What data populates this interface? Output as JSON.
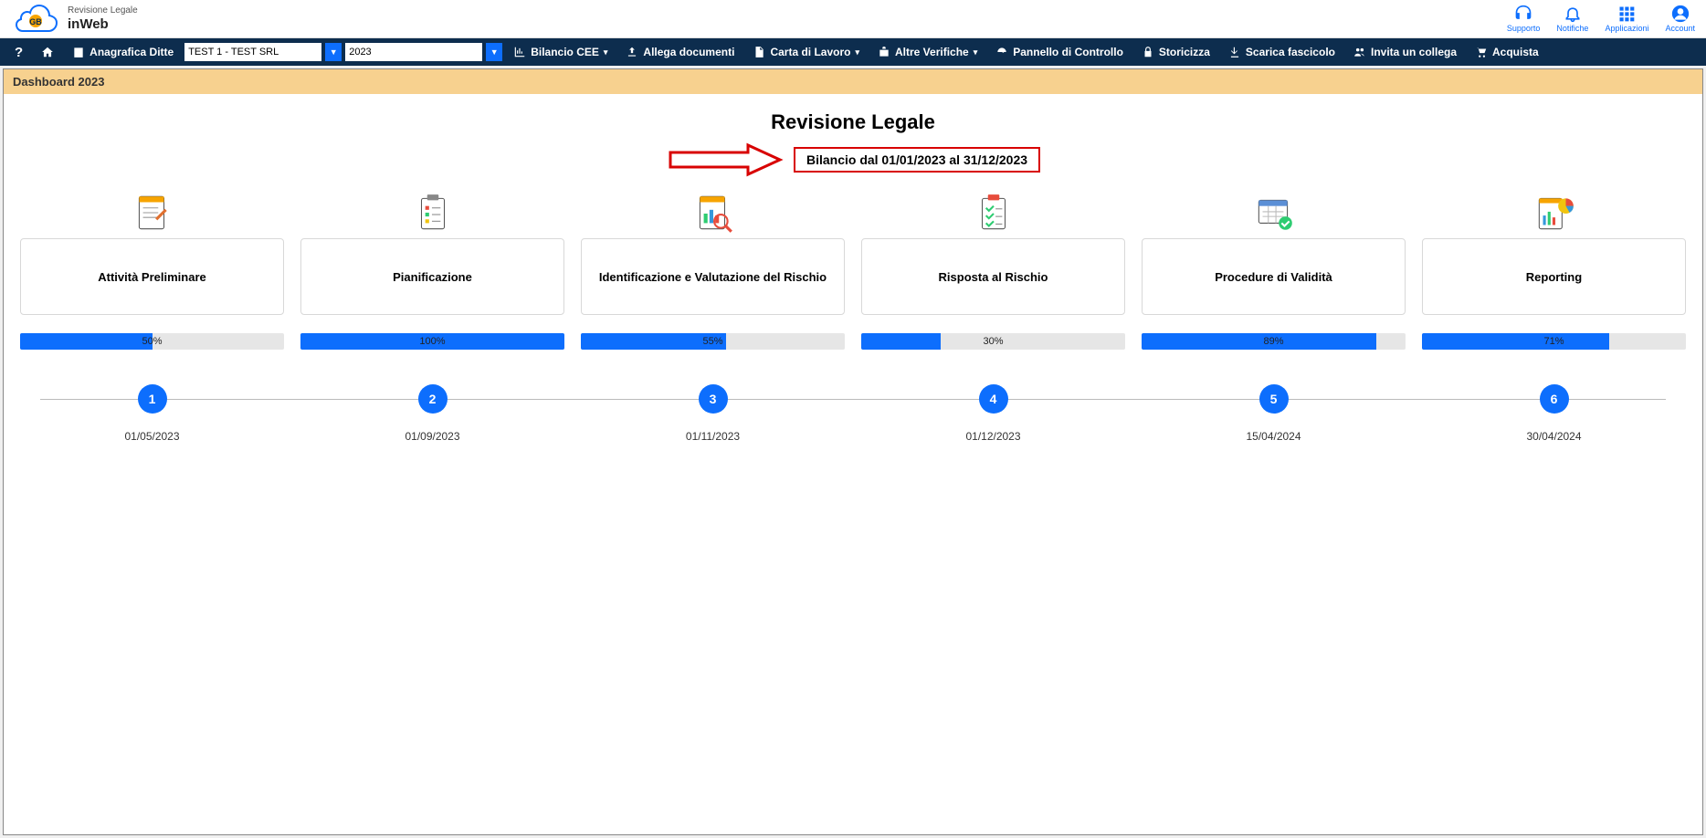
{
  "header": {
    "logo_line1": "Revisione Legale",
    "logo_line2": "inWeb",
    "right_items": [
      {
        "label": "Supporto"
      },
      {
        "label": "Notifiche"
      },
      {
        "label": "Applicazioni"
      },
      {
        "label": "Account"
      }
    ]
  },
  "toolbar": {
    "anagrafica_label": "Anagrafica Ditte",
    "company_value": "TEST 1 - TEST SRL",
    "year_value": "2023",
    "items": [
      {
        "label": "Bilancio CEE",
        "has_caret": true
      },
      {
        "label": "Allega documenti",
        "has_caret": false
      },
      {
        "label": "Carta di Lavoro",
        "has_caret": true
      },
      {
        "label": "Altre Verifiche",
        "has_caret": true
      },
      {
        "label": "Pannello di Controllo",
        "has_caret": false
      },
      {
        "label": "Storicizza",
        "has_caret": false
      },
      {
        "label": "Scarica fascicolo",
        "has_caret": false
      },
      {
        "label": "Invita un collega",
        "has_caret": false
      },
      {
        "label": "Acquista",
        "has_caret": false
      }
    ]
  },
  "dashboard": {
    "title": "Dashboard 2023",
    "section_title": "Revisione Legale",
    "bilancio_label": "Bilancio dal 01/01/2023 al 31/12/2023"
  },
  "phases": [
    {
      "title": "Attività Preliminare",
      "percent": 50,
      "percent_label": "50%",
      "step": "1",
      "date": "01/05/2023"
    },
    {
      "title": "Pianificazione",
      "percent": 100,
      "percent_label": "100%",
      "step": "2",
      "date": "01/09/2023"
    },
    {
      "title": "Identificazione e Valutazione del Rischio",
      "percent": 55,
      "percent_label": "55%",
      "step": "3",
      "date": "01/11/2023"
    },
    {
      "title": "Risposta al Rischio",
      "percent": 30,
      "percent_label": "30%",
      "step": "4",
      "date": "01/12/2023"
    },
    {
      "title": "Procedure di Validità",
      "percent": 89,
      "percent_label": "89%",
      "step": "5",
      "date": "15/04/2024"
    },
    {
      "title": "Reporting",
      "percent": 71,
      "percent_label": "71%",
      "step": "6",
      "date": "30/04/2024"
    }
  ]
}
